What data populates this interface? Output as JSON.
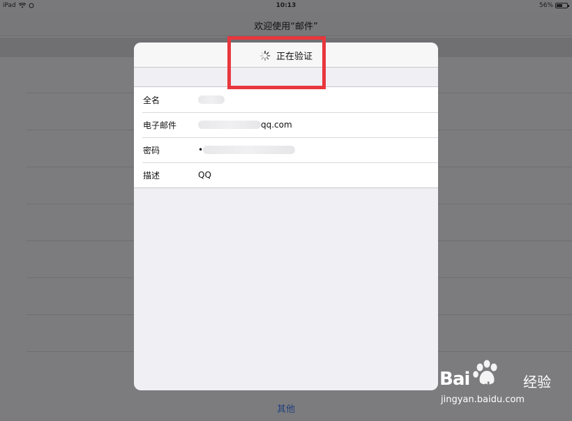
{
  "status_bar": {
    "device": "iPad",
    "time": "10:13",
    "battery_percent": "56%",
    "battery_level": 0.56
  },
  "nav": {
    "title": "欢迎使用“邮件”"
  },
  "modal": {
    "title": "正在验证",
    "rows": [
      {
        "label": "全名",
        "value": ""
      },
      {
        "label": "电子邮件",
        "value": "qq.com"
      },
      {
        "label": "密码",
        "value": "•"
      },
      {
        "label": "描述",
        "value": "QQ"
      }
    ]
  },
  "bottom": {
    "other_label": "其他"
  },
  "watermark": {
    "brand_left": "Bai",
    "brand_mid": "du",
    "brand_right": "经验",
    "url": "jingyan.baidu.com"
  },
  "colors": {
    "highlight": "#e8373d",
    "link": "#21407c"
  }
}
